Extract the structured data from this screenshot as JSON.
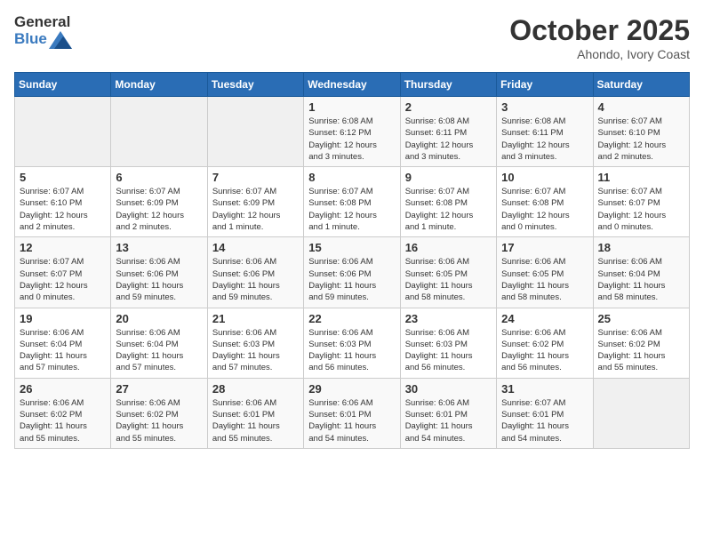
{
  "header": {
    "logo_general": "General",
    "logo_blue": "Blue",
    "month": "October 2025",
    "location": "Ahondo, Ivory Coast"
  },
  "weekdays": [
    "Sunday",
    "Monday",
    "Tuesday",
    "Wednesday",
    "Thursday",
    "Friday",
    "Saturday"
  ],
  "weeks": [
    [
      {
        "day": "",
        "info": ""
      },
      {
        "day": "",
        "info": ""
      },
      {
        "day": "",
        "info": ""
      },
      {
        "day": "1",
        "info": "Sunrise: 6:08 AM\nSunset: 6:12 PM\nDaylight: 12 hours\nand 3 minutes."
      },
      {
        "day": "2",
        "info": "Sunrise: 6:08 AM\nSunset: 6:11 PM\nDaylight: 12 hours\nand 3 minutes."
      },
      {
        "day": "3",
        "info": "Sunrise: 6:08 AM\nSunset: 6:11 PM\nDaylight: 12 hours\nand 3 minutes."
      },
      {
        "day": "4",
        "info": "Sunrise: 6:07 AM\nSunset: 6:10 PM\nDaylight: 12 hours\nand 2 minutes."
      }
    ],
    [
      {
        "day": "5",
        "info": "Sunrise: 6:07 AM\nSunset: 6:10 PM\nDaylight: 12 hours\nand 2 minutes."
      },
      {
        "day": "6",
        "info": "Sunrise: 6:07 AM\nSunset: 6:09 PM\nDaylight: 12 hours\nand 2 minutes."
      },
      {
        "day": "7",
        "info": "Sunrise: 6:07 AM\nSunset: 6:09 PM\nDaylight: 12 hours\nand 1 minute."
      },
      {
        "day": "8",
        "info": "Sunrise: 6:07 AM\nSunset: 6:08 PM\nDaylight: 12 hours\nand 1 minute."
      },
      {
        "day": "9",
        "info": "Sunrise: 6:07 AM\nSunset: 6:08 PM\nDaylight: 12 hours\nand 1 minute."
      },
      {
        "day": "10",
        "info": "Sunrise: 6:07 AM\nSunset: 6:08 PM\nDaylight: 12 hours\nand 0 minutes."
      },
      {
        "day": "11",
        "info": "Sunrise: 6:07 AM\nSunset: 6:07 PM\nDaylight: 12 hours\nand 0 minutes."
      }
    ],
    [
      {
        "day": "12",
        "info": "Sunrise: 6:07 AM\nSunset: 6:07 PM\nDaylight: 12 hours\nand 0 minutes."
      },
      {
        "day": "13",
        "info": "Sunrise: 6:06 AM\nSunset: 6:06 PM\nDaylight: 11 hours\nand 59 minutes."
      },
      {
        "day": "14",
        "info": "Sunrise: 6:06 AM\nSunset: 6:06 PM\nDaylight: 11 hours\nand 59 minutes."
      },
      {
        "day": "15",
        "info": "Sunrise: 6:06 AM\nSunset: 6:06 PM\nDaylight: 11 hours\nand 59 minutes."
      },
      {
        "day": "16",
        "info": "Sunrise: 6:06 AM\nSunset: 6:05 PM\nDaylight: 11 hours\nand 58 minutes."
      },
      {
        "day": "17",
        "info": "Sunrise: 6:06 AM\nSunset: 6:05 PM\nDaylight: 11 hours\nand 58 minutes."
      },
      {
        "day": "18",
        "info": "Sunrise: 6:06 AM\nSunset: 6:04 PM\nDaylight: 11 hours\nand 58 minutes."
      }
    ],
    [
      {
        "day": "19",
        "info": "Sunrise: 6:06 AM\nSunset: 6:04 PM\nDaylight: 11 hours\nand 57 minutes."
      },
      {
        "day": "20",
        "info": "Sunrise: 6:06 AM\nSunset: 6:04 PM\nDaylight: 11 hours\nand 57 minutes."
      },
      {
        "day": "21",
        "info": "Sunrise: 6:06 AM\nSunset: 6:03 PM\nDaylight: 11 hours\nand 57 minutes."
      },
      {
        "day": "22",
        "info": "Sunrise: 6:06 AM\nSunset: 6:03 PM\nDaylight: 11 hours\nand 56 minutes."
      },
      {
        "day": "23",
        "info": "Sunrise: 6:06 AM\nSunset: 6:03 PM\nDaylight: 11 hours\nand 56 minutes."
      },
      {
        "day": "24",
        "info": "Sunrise: 6:06 AM\nSunset: 6:02 PM\nDaylight: 11 hours\nand 56 minutes."
      },
      {
        "day": "25",
        "info": "Sunrise: 6:06 AM\nSunset: 6:02 PM\nDaylight: 11 hours\nand 55 minutes."
      }
    ],
    [
      {
        "day": "26",
        "info": "Sunrise: 6:06 AM\nSunset: 6:02 PM\nDaylight: 11 hours\nand 55 minutes."
      },
      {
        "day": "27",
        "info": "Sunrise: 6:06 AM\nSunset: 6:02 PM\nDaylight: 11 hours\nand 55 minutes."
      },
      {
        "day": "28",
        "info": "Sunrise: 6:06 AM\nSunset: 6:01 PM\nDaylight: 11 hours\nand 55 minutes."
      },
      {
        "day": "29",
        "info": "Sunrise: 6:06 AM\nSunset: 6:01 PM\nDaylight: 11 hours\nand 54 minutes."
      },
      {
        "day": "30",
        "info": "Sunrise: 6:06 AM\nSunset: 6:01 PM\nDaylight: 11 hours\nand 54 minutes."
      },
      {
        "day": "31",
        "info": "Sunrise: 6:07 AM\nSunset: 6:01 PM\nDaylight: 11 hours\nand 54 minutes."
      },
      {
        "day": "",
        "info": ""
      }
    ]
  ]
}
